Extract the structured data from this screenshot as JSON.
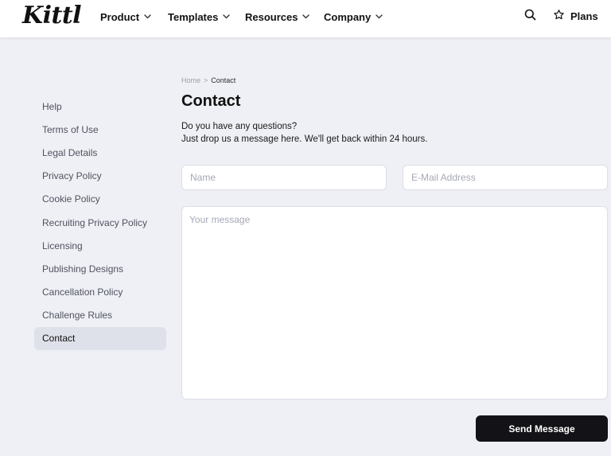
{
  "brand": {
    "logo_text": "Kittl"
  },
  "nav": {
    "items": [
      {
        "label": "Product",
        "icon": "chevron-down-icon"
      },
      {
        "label": "Templates",
        "icon": "chevron-down-icon"
      },
      {
        "label": "Resources",
        "icon": "chevron-down-icon"
      },
      {
        "label": "Company",
        "icon": "chevron-down-icon"
      }
    ],
    "search_icon": "search-icon",
    "plans_label": "Plans",
    "plans_icon": "star-outline-icon"
  },
  "sidebar": {
    "items": [
      {
        "label": "Help",
        "active": false
      },
      {
        "label": "Terms of Use",
        "active": false
      },
      {
        "label": "Legal Details",
        "active": false
      },
      {
        "label": "Privacy Policy",
        "active": false
      },
      {
        "label": "Cookie Policy",
        "active": false
      },
      {
        "label": "Recruiting Privacy Policy",
        "active": false
      },
      {
        "label": "Licensing",
        "active": false
      },
      {
        "label": "Publishing Designs",
        "active": false
      },
      {
        "label": "Cancellation Policy",
        "active": false
      },
      {
        "label": "Challenge Rules",
        "active": false
      },
      {
        "label": "Contact",
        "active": true
      }
    ]
  },
  "breadcrumb": {
    "home": "Home",
    "separator": ">",
    "current": "Contact"
  },
  "main": {
    "title": "Contact",
    "intro_line1": "Do you have any questions?",
    "intro_line2": "Just drop us a message here. We'll get back within 24 hours."
  },
  "form": {
    "name": {
      "placeholder": "Name",
      "value": ""
    },
    "email": {
      "placeholder": "E-Mail Address",
      "value": ""
    },
    "message": {
      "placeholder": "Your message",
      "value": ""
    },
    "submit_label": "Send Message"
  },
  "colors": {
    "page_bg": "#eff0f5",
    "header_bg": "#ffffff",
    "button_bg": "#121217",
    "active_item_bg": "#dfe1ea",
    "muted_text": "#4f5360"
  }
}
